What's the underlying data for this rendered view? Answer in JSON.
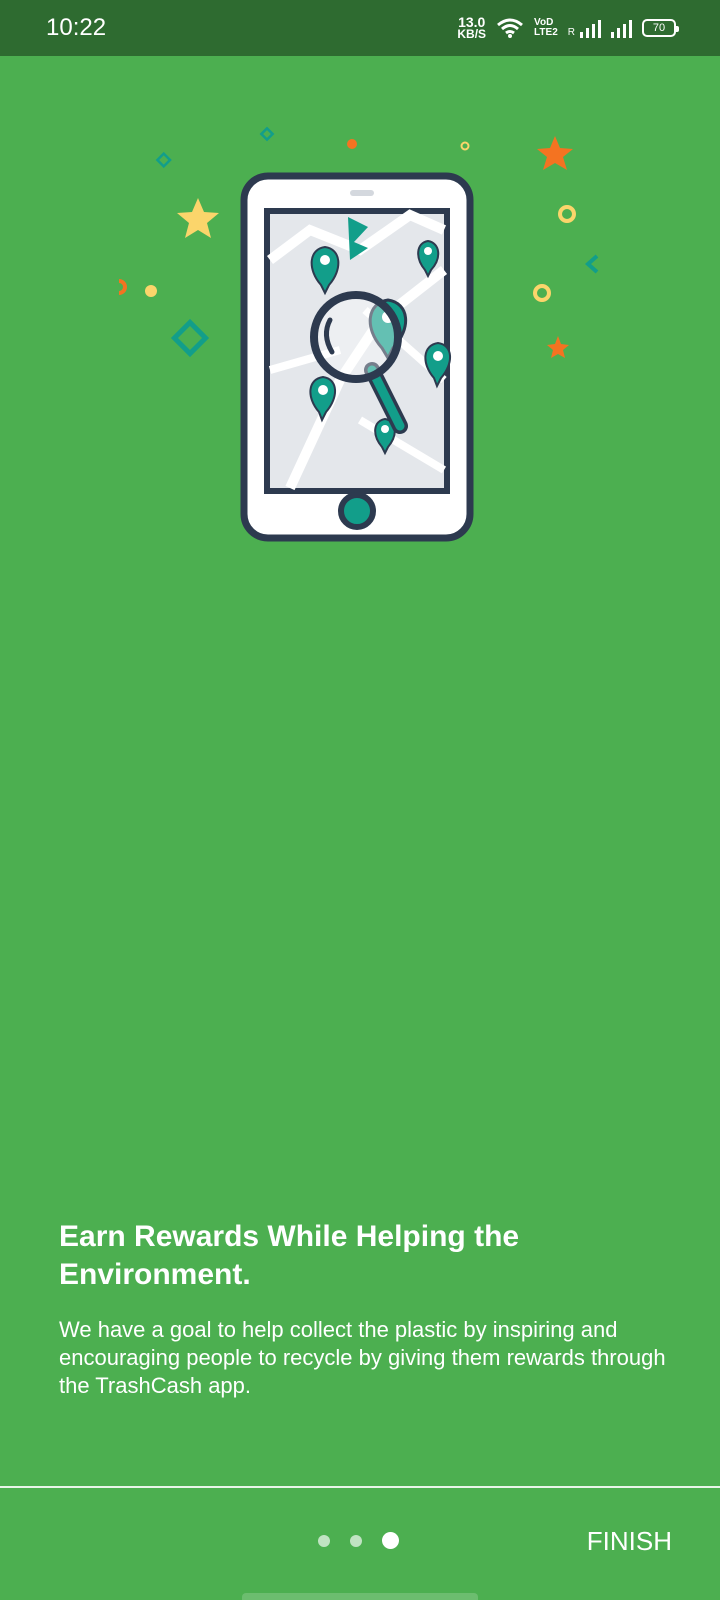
{
  "status_bar": {
    "time": "10:22",
    "net_speed_value": "13.0",
    "net_speed_unit": "KB/S",
    "vol_top": "VoD",
    "vol_bottom": "LTE2",
    "roaming": "R",
    "battery": "70"
  },
  "onboarding": {
    "title": "Earn Rewards While Helping the Environment.",
    "description": "We have a goal to help collect the plastic by inspiring and encouraging people to recycle by giving them rewards through the TrashCash app.",
    "pages": 3,
    "active_page": 3
  },
  "footer": {
    "finish_label": "FINISH"
  },
  "colors": {
    "background": "#4caf50",
    "status_bar": "#2e6b30",
    "phone_outline": "#2d3a4f",
    "teal_accent": "#129e8a",
    "star_yellow": "#fbd56b",
    "star_orange": "#f47321"
  },
  "icons": [
    "wifi-icon",
    "signal-icon",
    "battery-icon",
    "phone-map-illustration",
    "magnifier-icon",
    "map-pin-icon",
    "star-icon"
  ]
}
